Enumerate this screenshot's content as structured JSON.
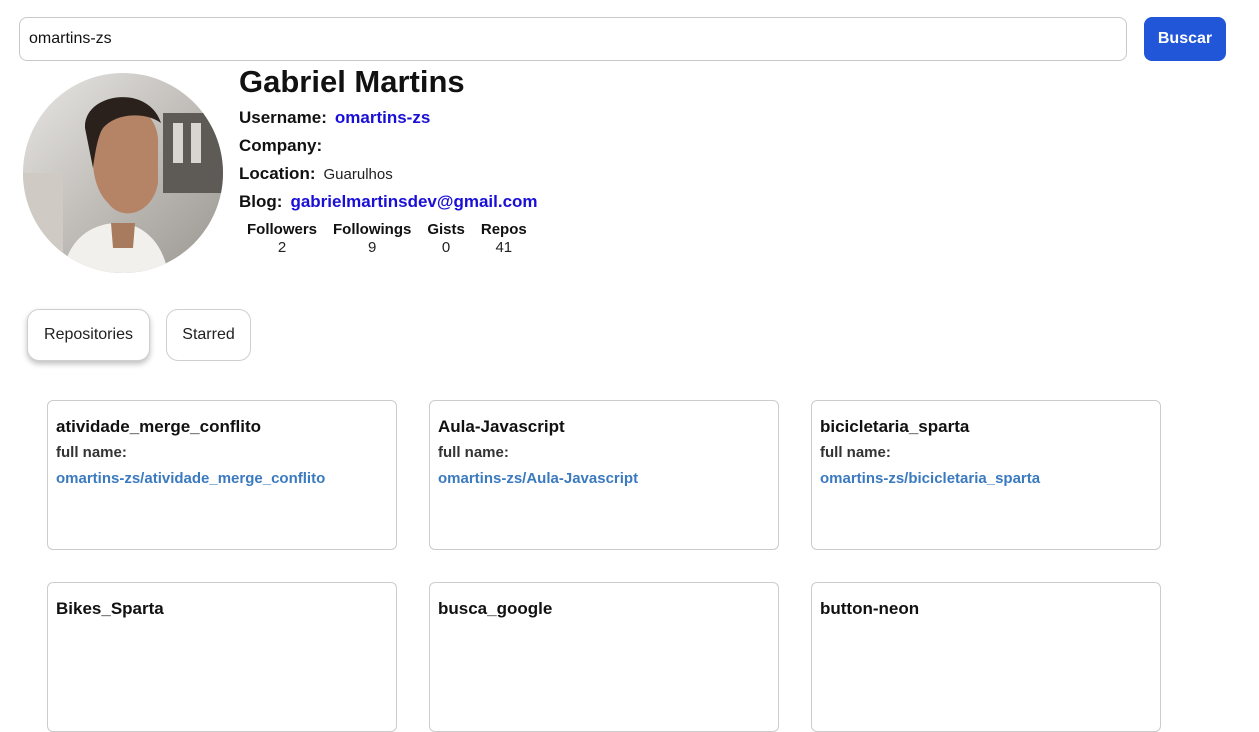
{
  "search": {
    "value": "omartins-zs",
    "button_label": "Buscar"
  },
  "profile": {
    "name": "Gabriel Martins",
    "username_label": "Username:",
    "username": "omartins-zs",
    "company_label": "Company:",
    "company": "",
    "location_label": "Location:",
    "location": "Guarulhos",
    "blog_label": "Blog:",
    "blog": "gabrielmartinsdev@gmail.com"
  },
  "stats": [
    {
      "label": "Followers",
      "value": "2"
    },
    {
      "label": "Followings",
      "value": "9"
    },
    {
      "label": "Gists",
      "value": "0"
    },
    {
      "label": "Repos",
      "value": "41"
    }
  ],
  "tabs": [
    {
      "label": "Repositories",
      "active": true
    },
    {
      "label": "Starred",
      "active": false
    }
  ],
  "repos": [
    {
      "name": "atividade_merge_conflito",
      "full_name_label": "full name:",
      "full_name": "omartins-zs/atividade_merge_conflito"
    },
    {
      "name": "Aula-Javascript",
      "full_name_label": "full name:",
      "full_name": "omartins-zs/Aula-Javascript"
    },
    {
      "name": "bicicletaria_sparta",
      "full_name_label": "full name:",
      "full_name": "omartins-zs/bicicletaria_sparta"
    },
    {
      "name": "Bikes_Sparta",
      "full_name_label": "",
      "full_name": ""
    },
    {
      "name": "busca_google",
      "full_name_label": "",
      "full_name": ""
    },
    {
      "name": "button-neon",
      "full_name_label": "",
      "full_name": ""
    }
  ],
  "colors": {
    "primary_button": "#2156d9",
    "link": "#1a0fd6",
    "repo_link": "#3b7abf"
  }
}
